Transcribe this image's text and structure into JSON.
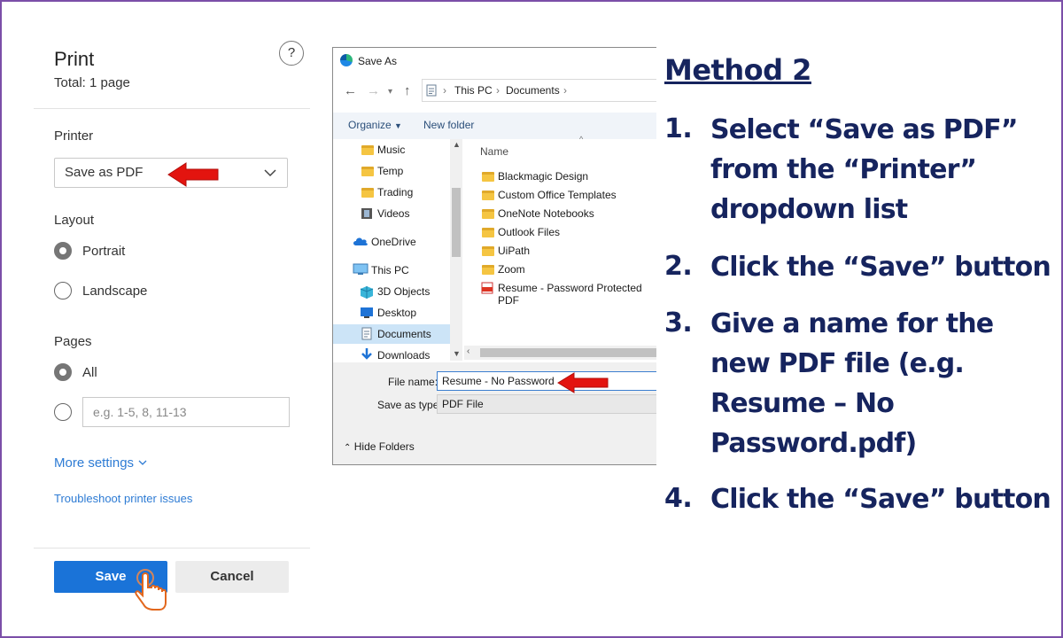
{
  "print_panel": {
    "title": "Print",
    "total": "Total: 1 page",
    "help_glyph": "?",
    "printer_label": "Printer",
    "printer_value": "Save as PDF",
    "layout_label": "Layout",
    "layout_options": [
      "Portrait",
      "Landscape"
    ],
    "pages_label": "Pages",
    "pages_all": "All",
    "pages_placeholder": "e.g. 1-5, 8, 11-13",
    "more_settings": "More settings",
    "troubleshoot": "Troubleshoot printer issues",
    "save_label": "Save",
    "cancel_label": "Cancel"
  },
  "dialog": {
    "title": "Save As",
    "breadcrumb": [
      "This PC",
      "Documents"
    ],
    "organize_label": "Organize",
    "new_folder_label": "New folder",
    "nav_items": [
      "Music",
      "Temp",
      "Trading",
      "Videos",
      "OneDrive",
      "This PC",
      "3D Objects",
      "Desktop",
      "Documents",
      "Downloads"
    ],
    "column_name": "Name",
    "files": [
      "Blackmagic Design",
      "Custom Office Templates",
      "OneNote Notebooks",
      "Outlook Files",
      "UiPath",
      "Zoom",
      "Resume - Password Protected PDF"
    ],
    "file_name_label": "File name:",
    "file_name_value": "Resume - No Password",
    "save_type_label": "Save as type:",
    "save_type_value": "PDF File",
    "hide_folders": "Hide Folders"
  },
  "instructions": {
    "heading": "Method 2",
    "steps": [
      {
        "num": "1.",
        "lines": [
          "Select “Save as PDF”",
          "from the “Printer”",
          "dropdown list"
        ]
      },
      {
        "num": "2.",
        "lines": [
          "Click the “Save” button"
        ]
      },
      {
        "num": "3.",
        "lines": [
          "Give a name for the",
          "new PDF file (e.g.",
          "Resume – No",
          "Password.pdf)"
        ]
      },
      {
        "num": "4.",
        "lines": [
          "Click the “Save” button"
        ]
      }
    ]
  },
  "colors": {
    "accent_blue": "#1a73d8",
    "arrow_red": "#e3140f",
    "heading_navy": "#16245e",
    "frame_purple": "#7b4fa8"
  },
  "icons": [
    "help-icon",
    "chevron-down-icon",
    "red-arrow-icon",
    "hand-cursor-icon",
    "edge-icon",
    "back-arrow-icon",
    "forward-arrow-icon",
    "up-arrow-icon",
    "folder-icon",
    "onedrive-icon",
    "computer-icon",
    "pdf-file-icon"
  ]
}
